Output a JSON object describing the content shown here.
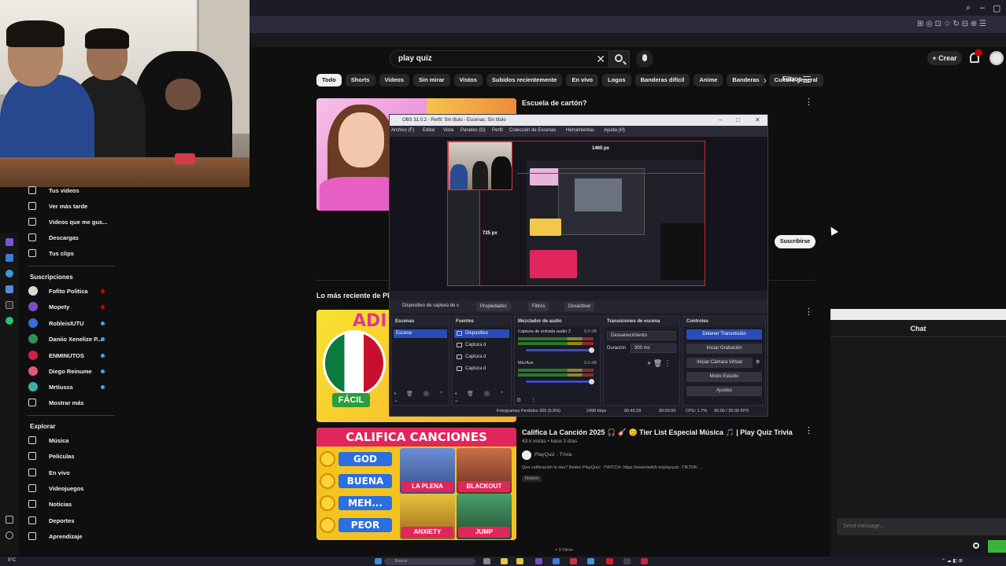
{
  "youtube": {
    "search": {
      "query": "play quiz"
    },
    "header": {
      "create_label": "+ Crear"
    },
    "chips": [
      "Todo",
      "Shorts",
      "Videos",
      "Sin mirar",
      "Vistos",
      "Subidos recientemente",
      "En vivo",
      "Logos",
      "Banderas difícil",
      "Anime",
      "Banderas",
      "Cultura general"
    ],
    "filters_label": "Filtros",
    "sidebar": {
      "you_items": [
        {
          "label": "Tus videos",
          "icon": "video-icon"
        },
        {
          "label": "Ver más tarde",
          "icon": "clock-icon"
        },
        {
          "label": "Videos que me gus...",
          "icon": "thumbs-up-icon"
        },
        {
          "label": "Descargas",
          "icon": "download-icon"
        },
        {
          "label": "Tus clips",
          "icon": "scissors-icon"
        }
      ],
      "subscriptions_title": "Suscripciones",
      "subscriptions": [
        {
          "label": "Fofito Politica",
          "avatar_color": "#d9d9d9",
          "live_color": "#cc0000"
        },
        {
          "label": "Mopety",
          "avatar_color": "#7a4cc2",
          "live_color": "#cc0000"
        },
        {
          "label": "RobleisIUTU",
          "avatar_color": "#3a6cd8",
          "live_color": "#3ea6ff"
        },
        {
          "label": "Daniio Xenelize P...",
          "avatar_color": "#2f8f5a",
          "live_color": "#3ea6ff"
        },
        {
          "label": "ENMINUTOS",
          "avatar_color": "#cc2244",
          "live_color": "#3ea6ff"
        },
        {
          "label": "Diego Reinume",
          "avatar_color": "#e05a7a",
          "live_color": "#3ea6ff"
        },
        {
          "label": "Mrtiusss",
          "avatar_color": "#3fb0a0",
          "live_color": "#3ea6ff"
        }
      ],
      "show_more_label": "Mostrar más",
      "explore_title": "Explorar",
      "explore": [
        {
          "label": "Música",
          "icon": "music-icon"
        },
        {
          "label": "Películas",
          "icon": "film-icon"
        },
        {
          "label": "En vivo",
          "icon": "live-icon"
        },
        {
          "label": "Videojuegos",
          "icon": "gamepad-icon"
        },
        {
          "label": "Noticias",
          "icon": "news-icon"
        },
        {
          "label": "Deportes",
          "icon": "trophy-icon"
        },
        {
          "label": "Aprendizaje",
          "icon": "lightbulb-icon"
        }
      ]
    },
    "results": {
      "video1_title": "Escuela de cartón?",
      "subscribe_label": "Suscribirse",
      "section_title": "Lo más reciente de PlayQuiz",
      "thumb2_top": "ADI",
      "thumb2_badge": "FÁCIL",
      "video3": {
        "title": "Califica La Canción 2025 🎧 🎸 😊 Tier List Especial Música 🎵 | Play Quiz Trivia",
        "meta": "43 k vistas • hace 3 días",
        "channel": "PlayQuiz - Trivia",
        "desc": "Que calificación le das? Redes PlayQuiz: -TWITCH: https://www.twitch.tv/playquiz -TIKTOK: ...",
        "badge": "Nuevo"
      },
      "thumb3": {
        "banner": "CALIFICA CANCIONES",
        "ratings": [
          "GOD",
          "BUENA",
          "MEH...",
          "PEOR"
        ],
        "tiles": [
          "LA PLENA",
          "BLACKOUT",
          "ANXIETY",
          "JUMP"
        ]
      }
    }
  },
  "obs": {
    "title": "OBS 31.0.2 - Perfil: Sin título - Escenas: Sin título",
    "menu": [
      "Archivo (F)",
      "Editar",
      "Vista",
      "Paneles (D)",
      "Perfil",
      "Colección de Escenas",
      "Herramientas",
      "Ayuda (H)"
    ],
    "preview": {
      "width_label": "1465 px",
      "height_label": "725 px"
    },
    "source_toolbar": {
      "source_name": "Dispositivo de captura de v",
      "properties": "Propiedades",
      "filters": "Filtros",
      "deactivate": "Desactivar"
    },
    "docks": {
      "scenes_title": "Escenas",
      "scenes": [
        "Escena"
      ],
      "sources_title": "Fuentes",
      "sources": [
        "Dispositivo",
        "Captura d",
        "Captura d",
        "Captura d"
      ],
      "mixer_title": "Mezclador de audio",
      "mixer": [
        {
          "name": "Captura de entrada audio 2",
          "db": "0.0 dB"
        },
        {
          "name": "Mic/Aux",
          "db": "0.0 dB"
        }
      ],
      "transitions_title": "Transiciones de escena",
      "transition": "Desvanecimiento",
      "duration_label": "Duración",
      "duration": "300 ms",
      "controls_title": "Controles",
      "controls": [
        "Detener Transmisión",
        "Iniciar Grabación",
        "Iniciar Cámara Virtual",
        "Modo Estudio",
        "Ajustes"
      ]
    },
    "status": {
      "dropped": "Fotogramas Perdidos 305 (5.6%)",
      "bitrate": "2490 kbps",
      "live_time": "00:45:28",
      "rec_time": "00:00:00",
      "cpu": "CPU: 1.7%",
      "fps": "30.00 / 30.00 FPS"
    }
  },
  "chat": {
    "title": "Chat",
    "placeholder": "Send message...",
    "accent": "#3cb43c"
  },
  "taskbar": {
    "temp": "9°C",
    "search": "Buscar",
    "pager": "+ 0 Otros"
  },
  "colors": {
    "yt_bg": "#0f0f0f",
    "obs_accent": "#284cb8",
    "live_red": "#cc0000"
  }
}
